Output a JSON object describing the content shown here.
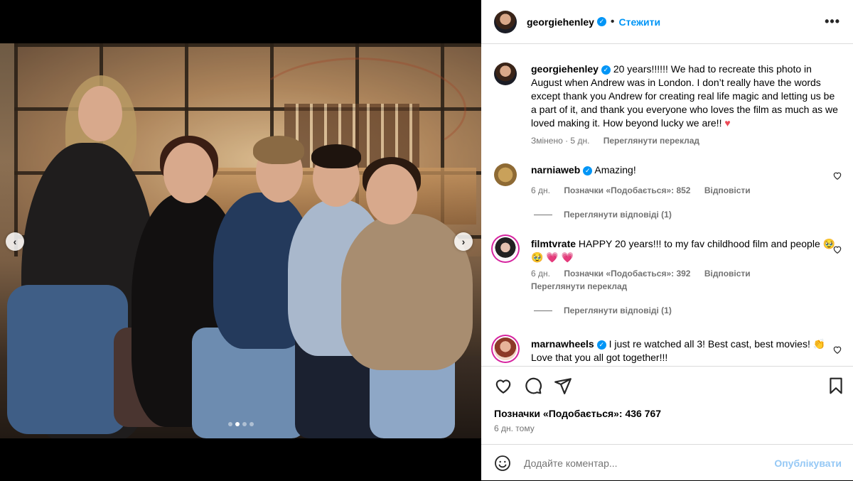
{
  "post": {
    "username": "georgiehenley",
    "follow_label": "Стежити",
    "dot": "•",
    "more": "•••"
  },
  "media": {
    "slides_total": 4,
    "active_slide": 2
  },
  "caption": {
    "username": "georgiehenley",
    "text": "20 years!!!!!! We had to recreate this photo in August when Andrew was in London. I don’t really have the words except thank you Andrew for creating real life magic and letting us be a part of it, and thank you everyone who loves the film as much as we loved making it. How beyond lucky we are!! ",
    "heart": "♥",
    "edited": "Змінено · 5 дн.",
    "translate": "Переглянути переклад"
  },
  "comments": [
    {
      "username": "narniaweb",
      "text": "Amazing!",
      "age": "6 дн.",
      "likes": "Позначки «Подобається»: 852",
      "reply": "Відповісти",
      "view_replies": "Переглянути відповіді (1)"
    },
    {
      "username": "filmtvrate",
      "text": "HAPPY 20 years!!! to my fav childhood film and people 🥹 🥹 💗 💗",
      "age": "6 дн.",
      "likes": "Позначки «Подобається»: 392",
      "reply": "Відповісти",
      "translate": "Переглянути переклад",
      "view_replies": "Переглянути відповіді (1)"
    },
    {
      "username": "marnawheels",
      "text": "I just re watched all 3! Best cast, best movies! 👏 Love that you all got together!!!"
    }
  ],
  "actions": {
    "likes": "Позначки «Подобається»: 436 767",
    "date": "6 дн. тому"
  },
  "composer": {
    "placeholder": "Додайте коментар...",
    "publish": "Опублікувати"
  },
  "colors": {
    "accent": "#0095f6",
    "like_red": "#ed4956",
    "muted": "#737373"
  }
}
